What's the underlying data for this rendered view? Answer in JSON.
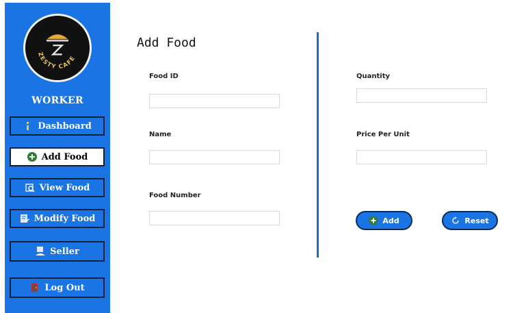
{
  "sidebar": {
    "logo_text": "ZESTY CAFE",
    "role": "WORKER",
    "items": [
      {
        "label": "Dashboard",
        "icon": "dashboard-icon"
      },
      {
        "label": "Add Food",
        "icon": "add-circle-icon",
        "active": true
      },
      {
        "label": "View Food",
        "icon": "view-icon"
      },
      {
        "label": "Modify Food",
        "icon": "edit-icon"
      },
      {
        "label": "Seller",
        "icon": "seller-icon"
      },
      {
        "label": "Log Out",
        "icon": "logout-icon"
      }
    ]
  },
  "main": {
    "title": "Add Food",
    "fields": {
      "food_id": {
        "label": "Food ID",
        "value": ""
      },
      "name": {
        "label": "Name",
        "value": ""
      },
      "food_number": {
        "label": "Food Number",
        "value": ""
      },
      "quantity": {
        "label": "Quantity",
        "value": ""
      },
      "price_per_unit": {
        "label": "Price Per Unit",
        "value": ""
      }
    },
    "buttons": {
      "add": "Add",
      "reset": "Reset"
    }
  },
  "colors": {
    "sidebar_bg": "#1b74e4",
    "accent_divider": "#1b6fc2",
    "button_border": "#0b2b55",
    "add_icon_green": "#2e7d32"
  }
}
